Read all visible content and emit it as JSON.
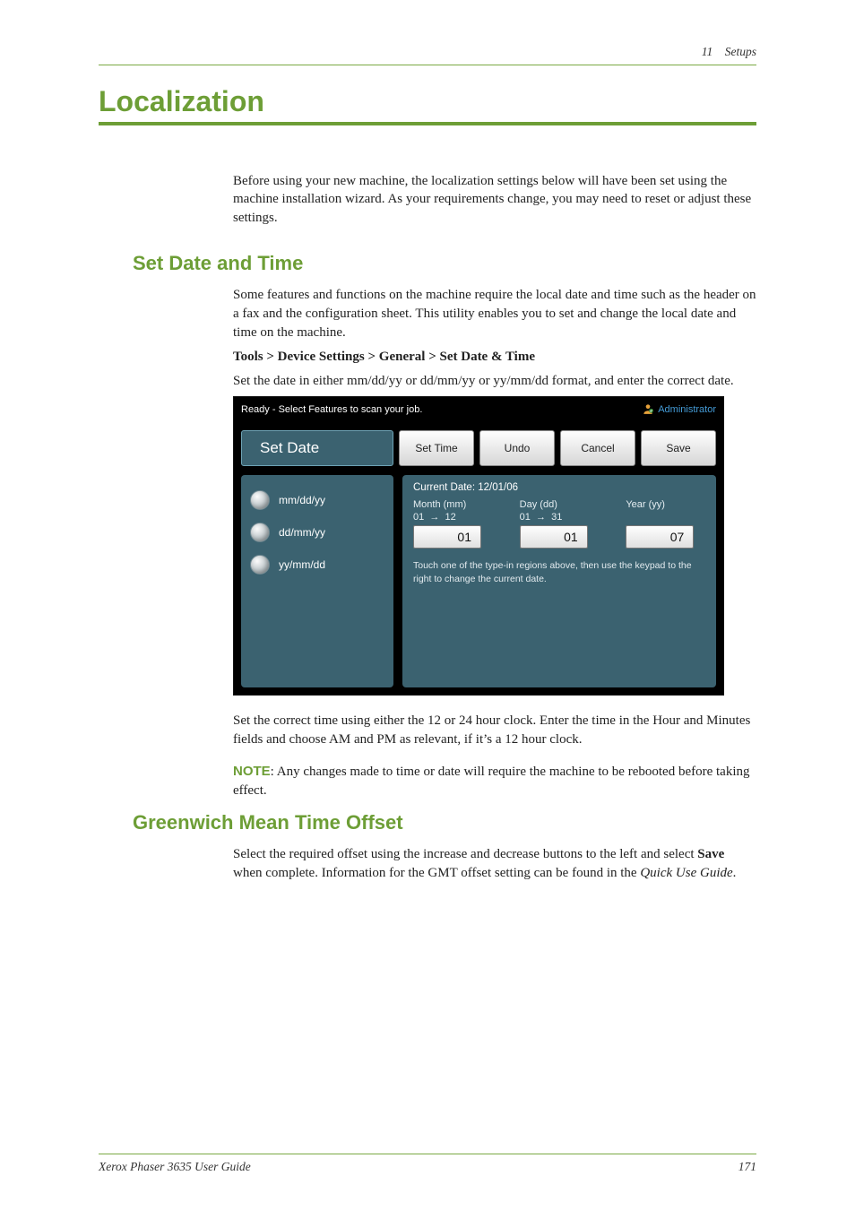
{
  "header": {
    "chapter": "11",
    "section": "Setups"
  },
  "title": "Localization",
  "intro": "Before using your new machine, the localization settings below will have been set using the machine installation wizard. As your requirements change, you may need to reset or adjust these settings.",
  "sec1": {
    "heading": "Set Date and Time",
    "p1": "Some features and functions on the machine require the local date and time such as the header on a fax and the configuration sheet. This utility enables you to set and change the local date and time on the machine.",
    "path": "Tools > Device Settings > General > Set Date & Time",
    "p2": "Set the date in either mm/dd/yy or dd/mm/yy or yy/mm/dd format, and enter the correct date.",
    "after1": "Set the correct time using either the 12 or 24 hour clock. Enter the time in the Hour and Minutes fields and choose AM and PM as relevant, if it’s a 12 hour clock.",
    "note_label": "NOTE",
    "note_text": ": Any changes made to time or date will require the machine to be rebooted before taking effect."
  },
  "sec2": {
    "heading": "Greenwich Mean Time Offset",
    "p1_a": "Select the required offset using the increase and decrease buttons to the left and select ",
    "save_word": "Save",
    "p1_b": " when complete. Information for the GMT offset setting can be found in the ",
    "guide_name": "Quick Use Guide",
    "period": "."
  },
  "ui": {
    "status": "Ready - Select Features to scan your job.",
    "admin": "Administrator",
    "tabs": {
      "active": "Set Date",
      "set_time": "Set Time",
      "undo": "Undo",
      "cancel": "Cancel",
      "save": "Save"
    },
    "radios": [
      "mm/dd/yy",
      "dd/mm/yy",
      "yy/mm/dd"
    ],
    "current_date_label": "Current Date: 12/01/06",
    "fields": {
      "month": {
        "label": "Month (mm)",
        "range_lo": "01",
        "range_hi": "12",
        "value": "01"
      },
      "day": {
        "label": "Day (dd)",
        "range_lo": "01",
        "range_hi": "31",
        "value": "01"
      },
      "year": {
        "label": "Year (yy)",
        "value": "07"
      }
    },
    "hint": "Touch one of the type-in regions above, then use the keypad to the right to change the current date."
  },
  "footer": {
    "doc": "Xerox Phaser 3635 User Guide",
    "page": "171"
  }
}
